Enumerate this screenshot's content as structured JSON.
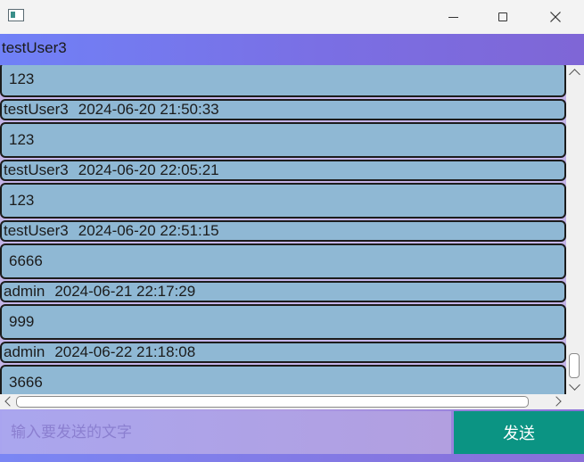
{
  "window": {
    "title": ""
  },
  "header": {
    "title": "testUser3"
  },
  "chat": {
    "messages": [
      {
        "sender": "",
        "time": "",
        "text": "123"
      },
      {
        "sender": "testUser3",
        "time": "2024-06-20 21:50:33",
        "text": "123"
      },
      {
        "sender": "testUser3",
        "time": "2024-06-20 22:05:21",
        "text": "123"
      },
      {
        "sender": "testUser3",
        "time": "2024-06-20 22:51:15",
        "text": "6666"
      },
      {
        "sender": "admin",
        "time": "2024-06-21 22:17:29",
        "text": "999"
      },
      {
        "sender": "admin",
        "time": "2024-06-22 21:18:08",
        "text": "3666"
      }
    ]
  },
  "composer": {
    "placeholder": "输入要发送的文字",
    "send_label": "发送"
  },
  "colors": {
    "header_gradient_start": "#7081f7",
    "header_gradient_end": "#7f66d6",
    "bubble": "#8fb8d4",
    "chat_background": "#c4b4e8",
    "send_button": "#0b9483"
  }
}
